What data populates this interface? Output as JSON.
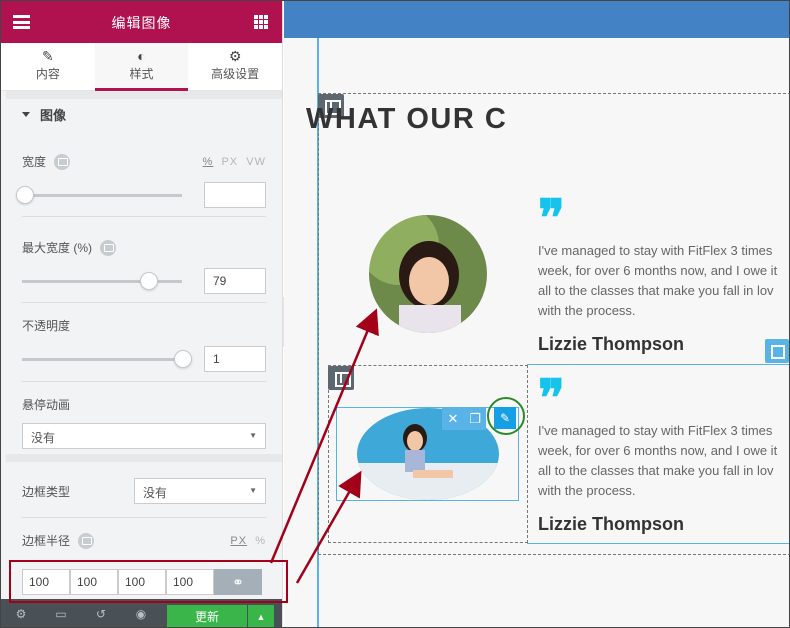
{
  "sidebar": {
    "title": "编辑图像",
    "tabs": [
      {
        "label": "内容",
        "icon": "pencil-icon"
      },
      {
        "label": "样式",
        "icon": "contrast-icon"
      },
      {
        "label": "高级设置",
        "icon": "gear-icon"
      }
    ],
    "section_title": "图像",
    "width": {
      "label": "宽度",
      "units": [
        "%",
        "PX",
        "VW"
      ],
      "value": "",
      "fraction": 0.0
    },
    "max_width": {
      "label": "最大宽度 (%)",
      "value": "79",
      "fraction": 0.79
    },
    "opacity": {
      "label": "不透明度",
      "value": "1",
      "fraction": 1.0
    },
    "hover_animation": {
      "label": "悬停动画",
      "value": "没有"
    },
    "border_type": {
      "label": "边框类型",
      "value": "没有"
    },
    "border_radius": {
      "label": "边框半径",
      "unit": "PX",
      "unit_alt": "%",
      "values": [
        "100",
        "100",
        "100",
        "100"
      ]
    },
    "footer": {
      "update_label": "更新"
    }
  },
  "preview": {
    "heading": "WHAT OUR C",
    "testimonials": [
      {
        "lines": [
          "I've managed to stay with FitFlex 3 times",
          "week, for over 6 months now, and I owe it",
          "all to the classes that make you fall in lov",
          "with the process."
        ],
        "name": "Lizzie Thompson"
      },
      {
        "lines": [
          "I've managed to stay with FitFlex 3 times",
          "week, for over 6 months now, and I owe it",
          "all to the classes that make you fall in lov",
          "with the process."
        ],
        "name": "Lizzie Thompson"
      }
    ]
  },
  "colors": {
    "header": "#b0124f",
    "topbar": "#4383c5",
    "accent": "#15c4ec",
    "update": "#39b54a",
    "annotation": "#a3001a"
  }
}
